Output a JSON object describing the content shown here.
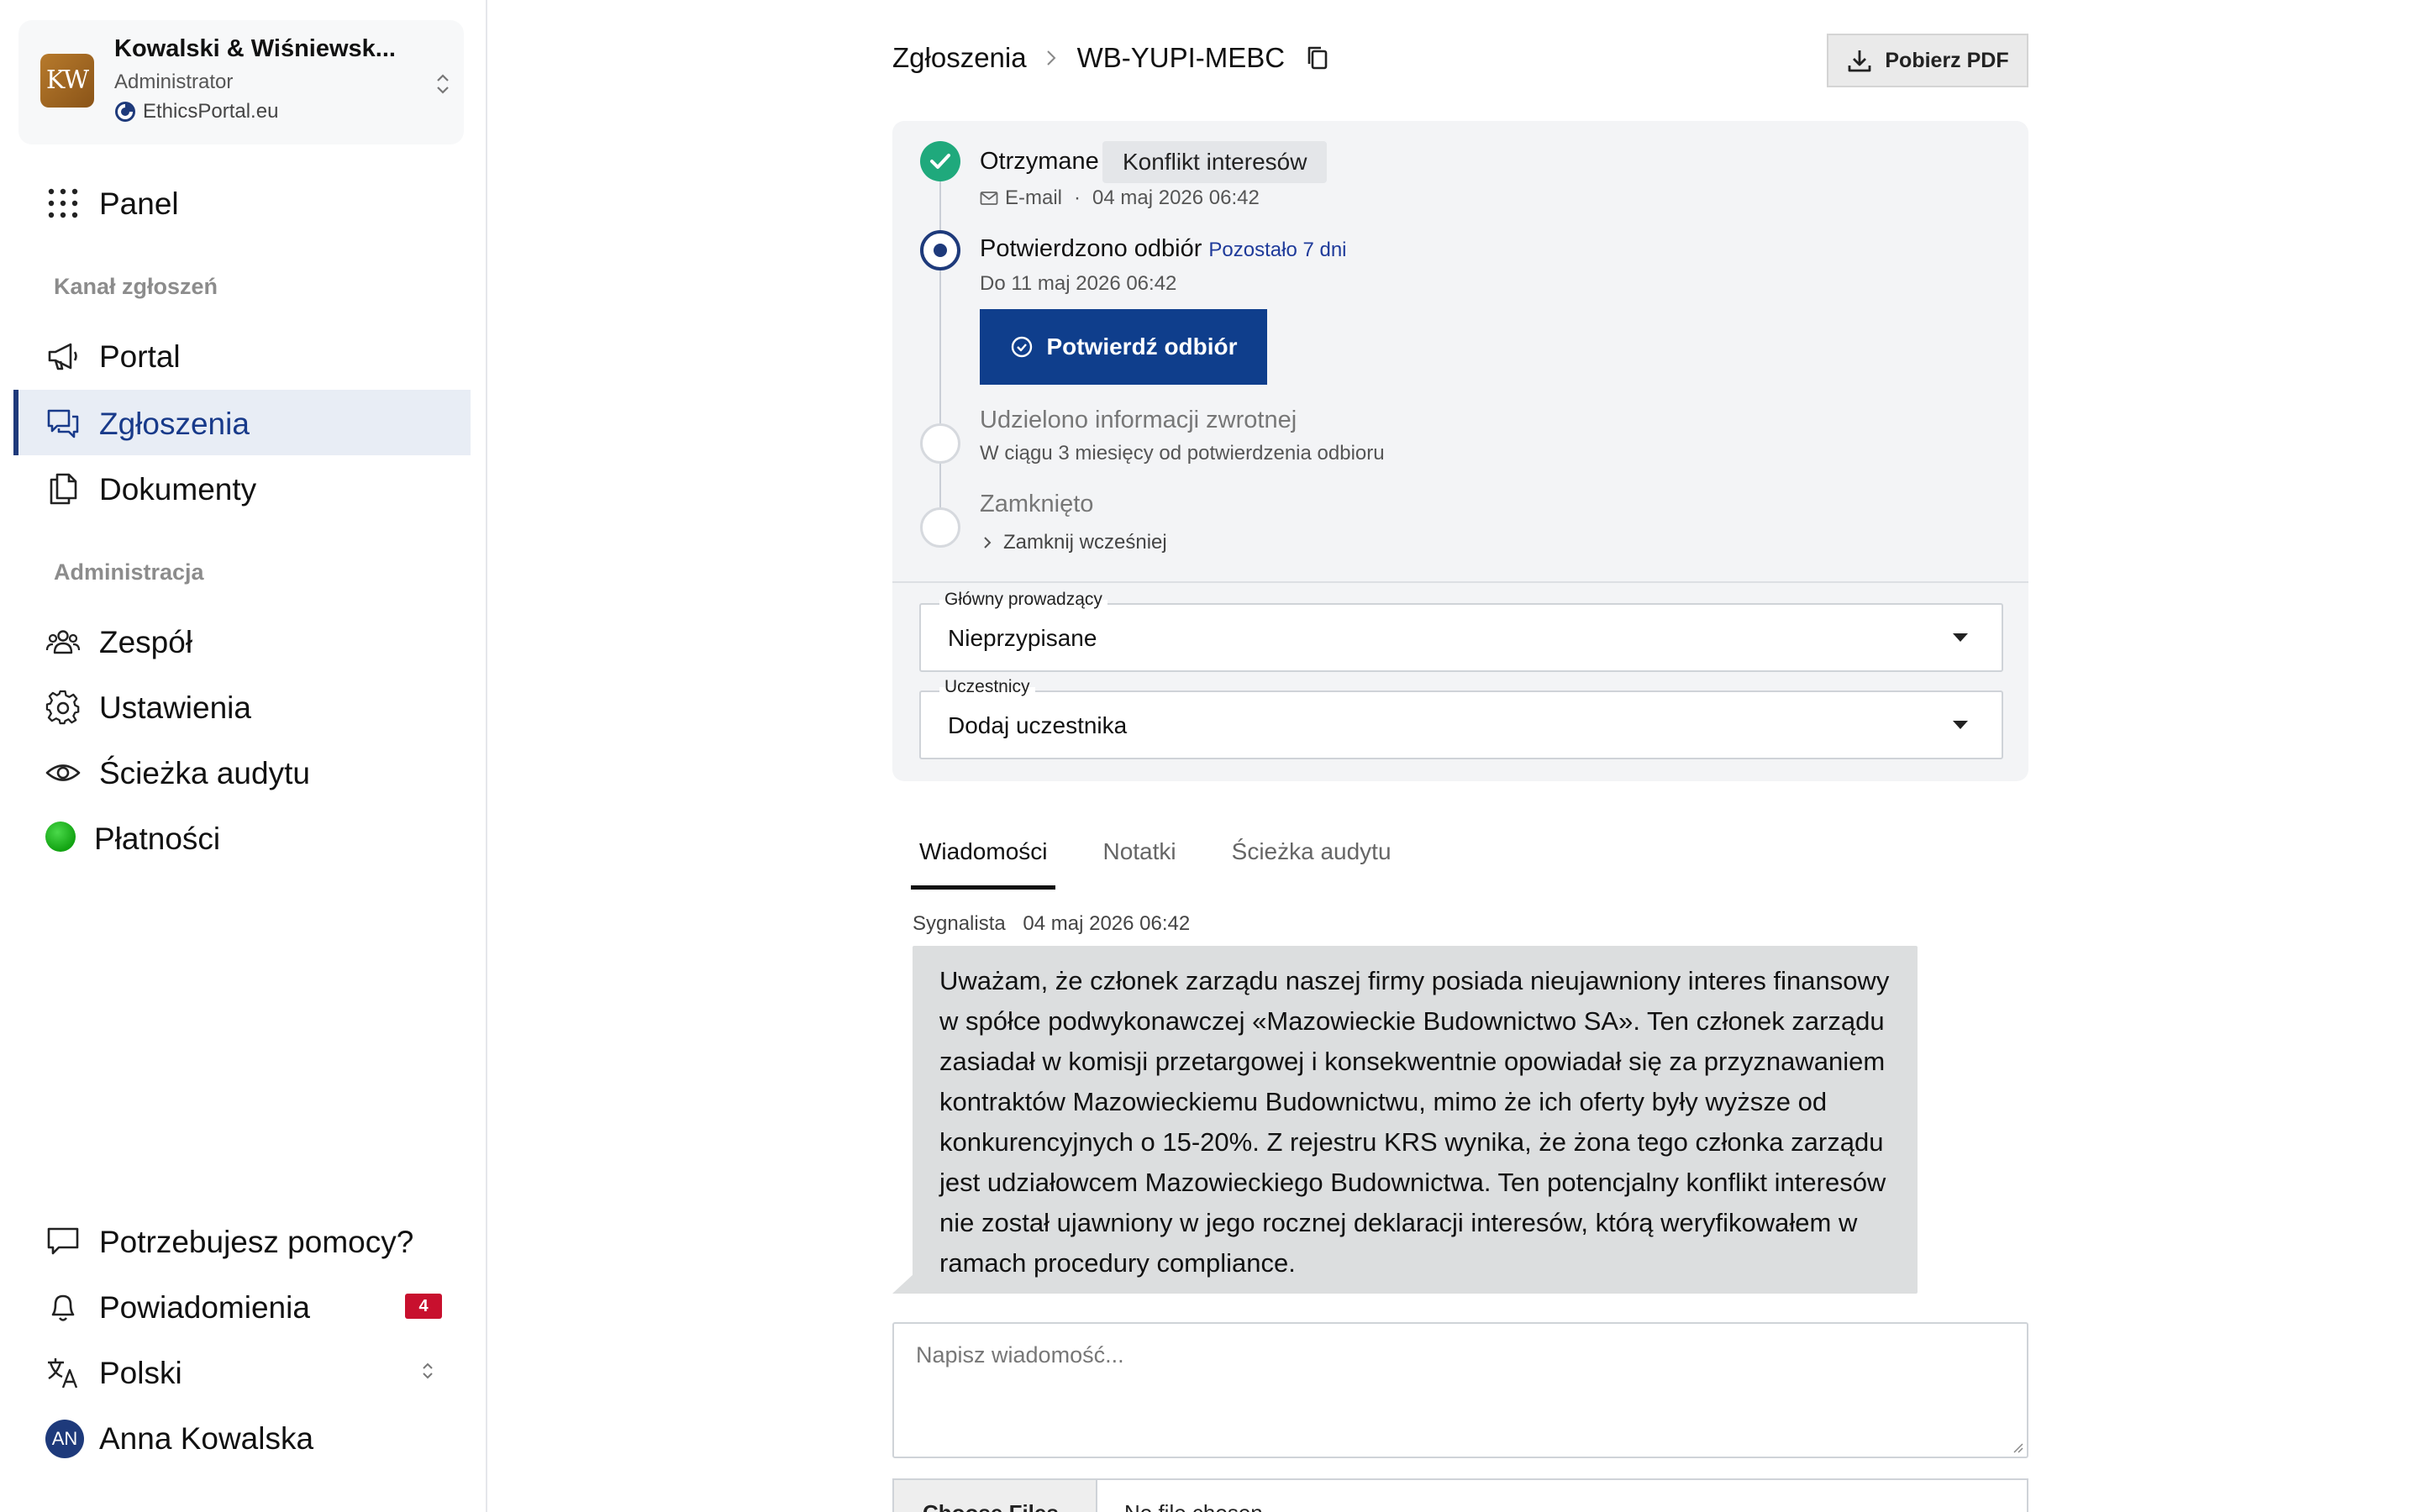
{
  "org": {
    "initials": "KW",
    "name": "Kowalski & Wiśniewsk...",
    "role": "Administrator",
    "portal": "EthicsPortal.eu"
  },
  "nav": {
    "panel": "Panel",
    "section_channel": "Kanał zgłoszeń",
    "portal": "Portal",
    "reports": "Zgłoszenia",
    "documents": "Dokumenty",
    "section_admin": "Administracja",
    "team": "Zespół",
    "settings": "Ustawienia",
    "audit": "Ścieżka audytu",
    "payments": "Płatności",
    "help": "Potrzebujesz pomocy?",
    "notifications": "Powiadomienia",
    "notifications_count": "4",
    "language": "Polski",
    "user_initials": "AN",
    "user_name": "Anna Kowalska"
  },
  "header": {
    "breadcrumb_root": "Zgłoszenia",
    "case_id": "WB-YUPI-MEBC",
    "pdf_button": "Pobierz PDF"
  },
  "timeline": {
    "received": {
      "title": "Otrzymane",
      "tag": "Konflikt interesów",
      "channel": "E-mail",
      "separator": "·",
      "date": "04 maj 2026 06:42"
    },
    "confirmed": {
      "title": "Potwierdzono odbiór",
      "remaining": "Pozostało 7 dni",
      "deadline": "Do 11 maj 2026 06:42",
      "button": "Potwierdź odbiór"
    },
    "feedback": {
      "title": "Udzielono informacji zwrotnej",
      "sub": "W ciągu 3 miesięcy od potwierdzenia odbioru"
    },
    "closed": {
      "title": "Zamknięto",
      "close_early": "Zamknij wcześniej"
    }
  },
  "fields": {
    "lead_label": "Główny prowadzący",
    "lead_value": "Nieprzypisane",
    "participants_label": "Uczestnicy",
    "participants_value": "Dodaj uczestnika"
  },
  "tabs": {
    "messages": "Wiadomości",
    "notes": "Notatki",
    "audit": "Ścieżka audytu"
  },
  "message": {
    "author": "Sygnalista",
    "date": "04 maj 2026 06:42",
    "body": "Uważam, że członek zarządu naszej firmy posiada nieujawniony interes finansowy w spółce podwykonawczej «Mazowieckie Budownictwo SA». Ten członek zarządu zasiadał w komisji przetargowej i konsekwentnie opowiadał się za przyznawaniem kontraktów Mazowieckiemu Budownictwu, mimo że ich oferty były wyższe od konkurencyjnych o 15-20%. Z rejestru KRS wynika, że żona tego członka zarządu jest udziałowcem Mazowieckiego Budownictwa. Ten potencjalny konflikt interesów nie został ujawniony w jego rocznej deklaracji interesów, którą weryfikowałem w ramach procedury compliance."
  },
  "composer": {
    "placeholder": "Napisz wiadomość...",
    "file_button": "Choose Files",
    "file_status": "No file chosen"
  },
  "colors": {
    "primary": "#0f3e8c",
    "success": "#1fa97c",
    "badge": "#c8102e",
    "active_nav_bg": "#e8edf5"
  }
}
